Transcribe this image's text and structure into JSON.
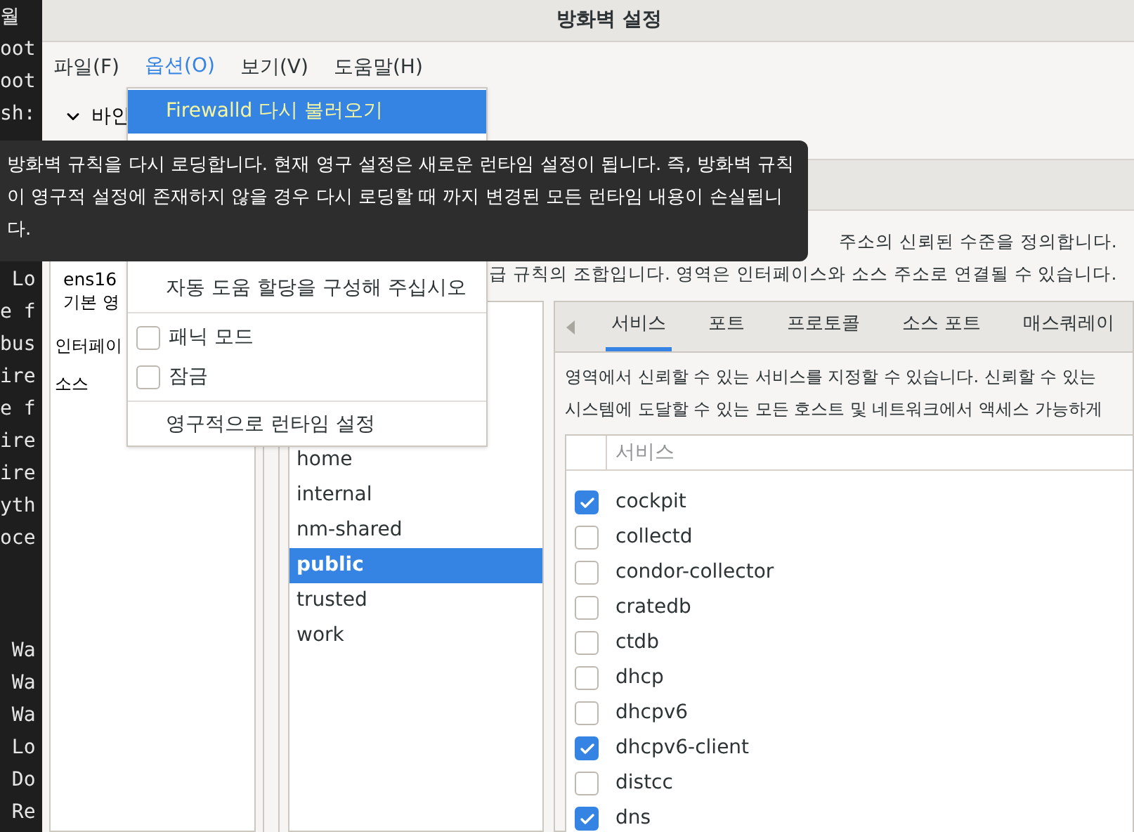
{
  "terminal": {
    "blocks": [
      {
        "lines": [
          "월",
          "oot",
          "oot",
          "sh:"
        ]
      },
      {
        "lines": [
          " Lo",
          "e f",
          "bus",
          "ire",
          "e f",
          "ire",
          "ire",
          "yth",
          "oce"
        ]
      },
      {
        "lines": [
          " Wa",
          " Wa",
          " Wa",
          " Lo",
          " Do",
          " Re"
        ]
      }
    ]
  },
  "window": {
    "title": "방화벽 설정"
  },
  "menubar": [
    {
      "label": "파일(F)",
      "selected": false
    },
    {
      "label": "옵션(O)",
      "selected": true
    },
    {
      "label": "보기(V)",
      "selected": false
    },
    {
      "label": "도움말(H)",
      "selected": false
    }
  ],
  "bindings": {
    "label": "바인",
    "expanded": true
  },
  "left_panel": {
    "items": [
      {
        "kind": "entry",
        "label": "ens16",
        "sub": "기본 영"
      },
      {
        "kind": "header",
        "label": "인터페이"
      },
      {
        "kind": "header",
        "label": "소스"
      }
    ]
  },
  "description": [
    "주소의 신뢰된 수준을 정의합니다.",
    "급 규칙의 조합입니다. 영역은 인터페이스와 소스 주소로 연결될 수 있습니다."
  ],
  "zones": [
    {
      "label": "home",
      "selected": false
    },
    {
      "label": "internal",
      "selected": false
    },
    {
      "label": "nm-shared",
      "selected": false
    },
    {
      "label": "public",
      "selected": true
    },
    {
      "label": "trusted",
      "selected": false
    },
    {
      "label": "work",
      "selected": false
    }
  ],
  "tabs": [
    {
      "label": "서비스",
      "selected": true
    },
    {
      "label": "포트",
      "selected": false
    },
    {
      "label": "프로토콜",
      "selected": false
    },
    {
      "label": "소스 포트",
      "selected": false
    },
    {
      "label": "매스쿼레이",
      "selected": false
    }
  ],
  "services_help": [
    "영역에서 신뢰할 수 있는 서비스를 지정할 수 있습니다. 신뢰할 수 있는",
    "시스템에 도달할 수 있는 모든 호스트 및 네트워크에서 액세스 가능하게"
  ],
  "services_table": {
    "column": "서비스",
    "rows": [
      {
        "name": "cockpit",
        "checked": true
      },
      {
        "name": "collectd",
        "checked": false
      },
      {
        "name": "condor-collector",
        "checked": false
      },
      {
        "name": "cratedb",
        "checked": false
      },
      {
        "name": "ctdb",
        "checked": false
      },
      {
        "name": "dhcp",
        "checked": false
      },
      {
        "name": "dhcpv6",
        "checked": false
      },
      {
        "name": "dhcpv6-client",
        "checked": true
      },
      {
        "name": "distcc",
        "checked": false
      },
      {
        "name": "dns",
        "checked": true
      }
    ]
  },
  "options_menu": {
    "items": [
      {
        "kind": "action",
        "label": "Firewalld 다시 불러오기",
        "selected": true
      },
      {
        "kind": "action",
        "label": "자동 도움 할당을 구성해 주십시오",
        "selected": false
      },
      {
        "kind": "separator"
      },
      {
        "kind": "check",
        "label": "패닉 모드",
        "checked": false,
        "selected": false
      },
      {
        "kind": "check",
        "label": "잠금",
        "checked": false,
        "selected": false
      },
      {
        "kind": "separator"
      },
      {
        "kind": "action",
        "label": "영구적으로 런타임 설정",
        "selected": false
      }
    ]
  },
  "tooltip": "방화벽 규칙을 다시 로딩합니다. 현재 영구 설정은 새로운 런타임 설정이 됩니다. 즉, 방화벽 규칙 이 영구적 설정에 존재하지 않을 경우 다시 로딩할 때 까지 변경된 모든 런타임 내용이 손실됩니 다."
}
